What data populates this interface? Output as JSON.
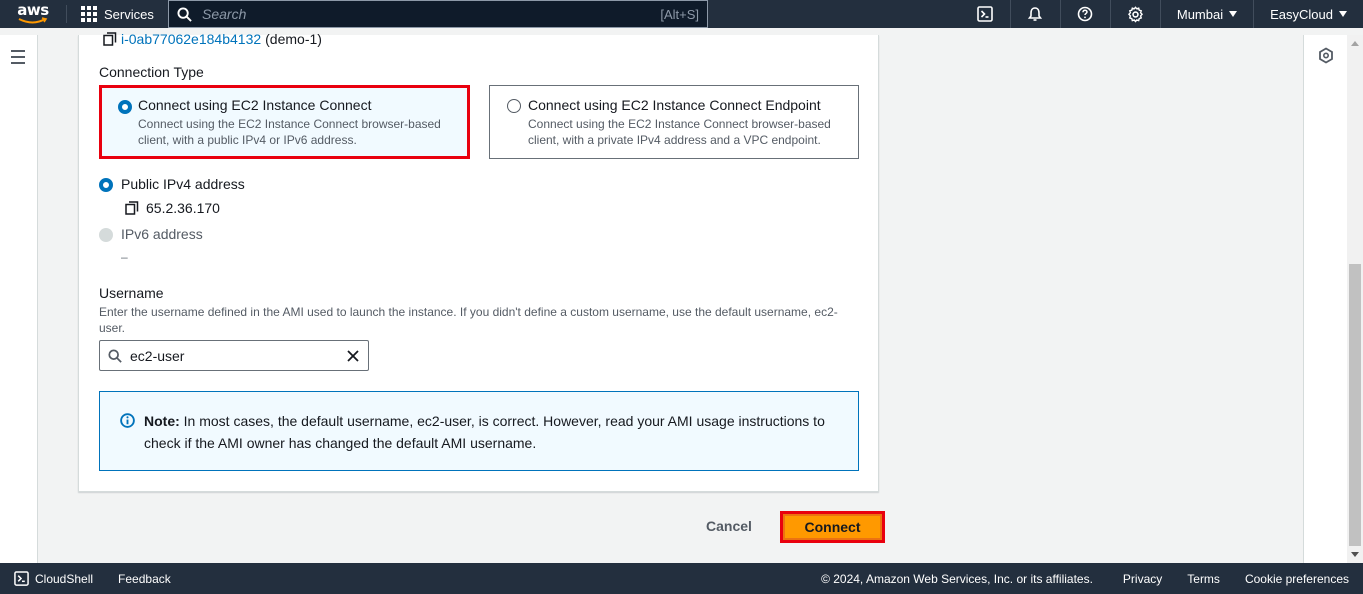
{
  "topnav": {
    "logo_text": "aws",
    "services_label": "Services",
    "search_placeholder": "Search",
    "search_shortcut": "[Alt+S]",
    "region_label": "Mumbai",
    "account_label": "EasyCloud"
  },
  "instance": {
    "id": "i-0ab77062e184b4132",
    "name": "(demo-1)"
  },
  "connection_type": {
    "label": "Connection Type",
    "options": [
      {
        "label": "Connect using EC2 Instance Connect",
        "description_line1": "Connect using the EC2 Instance Connect browser-based",
        "description_line2": "client, with a public IPv4 or IPv6 address.",
        "selected": true
      },
      {
        "label": "Connect using EC2 Instance Connect Endpoint",
        "description_line1": "Connect using the EC2 Instance Connect browser-based",
        "description_line2": "client, with a private IPv4 address and a VPC endpoint.",
        "selected": false
      }
    ]
  },
  "address": {
    "ipv4_label": "Public IPv4 address",
    "ipv4_value": "65.2.36.170",
    "ipv6_label": "IPv6 address",
    "ipv6_value": "–"
  },
  "username": {
    "label": "Username",
    "description": "Enter the username defined in the AMI used to launch the instance. If you didn't define a custom username, use the default username, ec2-user.",
    "value": "ec2-user"
  },
  "note": {
    "bold": "Note:",
    "text": " In most cases, the default username, ec2-user, is correct. However, read your AMI usage instructions to check if the AMI owner has changed the default AMI username."
  },
  "actions": {
    "cancel_label": "Cancel",
    "connect_label": "Connect"
  },
  "footer": {
    "cloudshell_label": "CloudShell",
    "feedback_label": "Feedback",
    "copyright": "© 2024, Amazon Web Services, Inc. or its affiliates.",
    "privacy_label": "Privacy",
    "terms_label": "Terms",
    "cookie_label": "Cookie preferences"
  },
  "colors": {
    "nav_bg": "#232f3e",
    "accent_blue": "#0073bb",
    "highlight_red": "#e9000e",
    "primary_orange": "#ff9900"
  }
}
